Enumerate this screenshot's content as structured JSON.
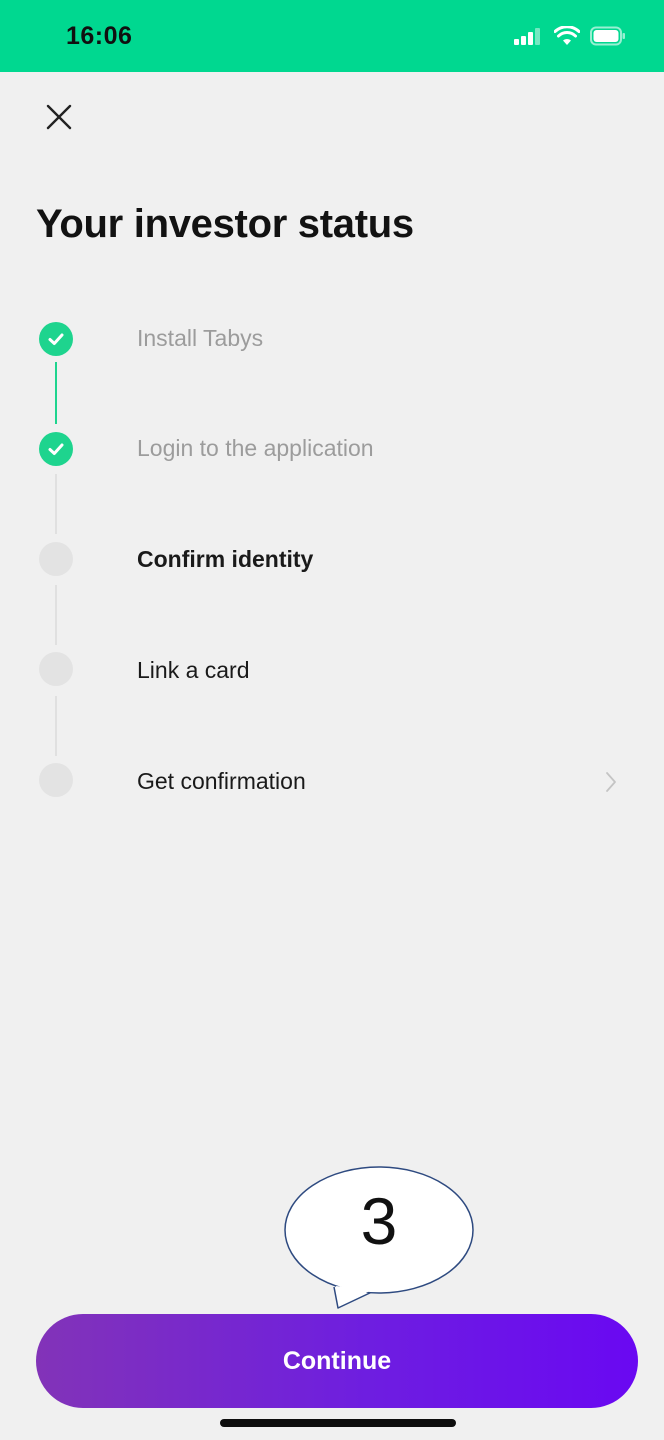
{
  "status_bar": {
    "time": "16:06",
    "icons": [
      "cellular-signal-icon",
      "wifi-icon",
      "battery-icon"
    ],
    "background": "#00d890"
  },
  "header": {
    "close_icon": "close-icon"
  },
  "page": {
    "title": "Your investor status"
  },
  "steps": [
    {
      "label": "Install Tabys",
      "status": "done"
    },
    {
      "label": "Login to the application",
      "status": "done"
    },
    {
      "label": "Confirm identity",
      "status": "active"
    },
    {
      "label": "Link a card",
      "status": "pending"
    },
    {
      "label": "Get confirmation",
      "status": "pending"
    }
  ],
  "annotation": {
    "number": "3"
  },
  "footer": {
    "continue_label": "Continue"
  },
  "colors": {
    "accent_green": "#1ed48e",
    "button_gradient_start": "#8233b8",
    "button_gradient_end": "#6a08f2"
  }
}
